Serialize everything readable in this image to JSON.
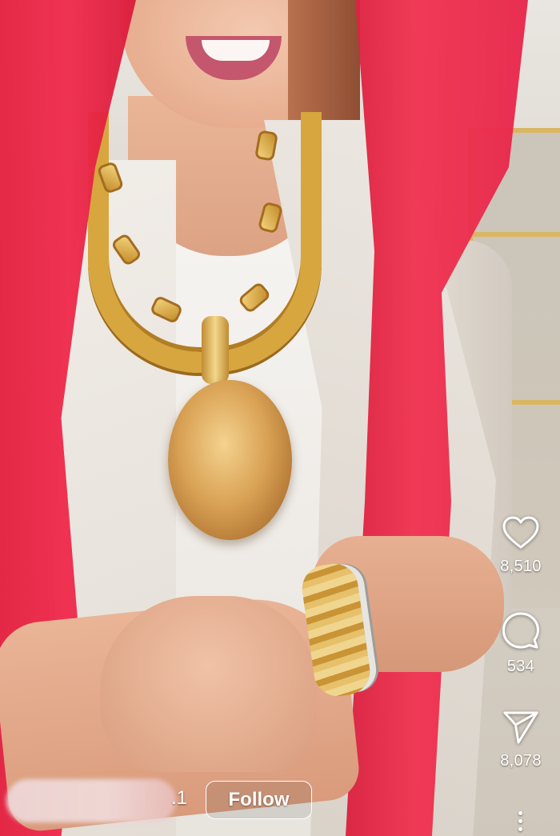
{
  "actions": {
    "likes": {
      "icon": "heart-icon",
      "count": "8,510"
    },
    "comments": {
      "icon": "comment-icon",
      "count": "534"
    },
    "shares": {
      "icon": "share-icon",
      "count": "8,078"
    },
    "more": {
      "icon": "more-icon"
    }
  },
  "author": {
    "name_visible_suffix": ".1",
    "follow_label": "Follow"
  },
  "colors": {
    "overlay_text": "#ffffff",
    "scarf_red": "#e8254a",
    "gold": "#d7a63f"
  }
}
